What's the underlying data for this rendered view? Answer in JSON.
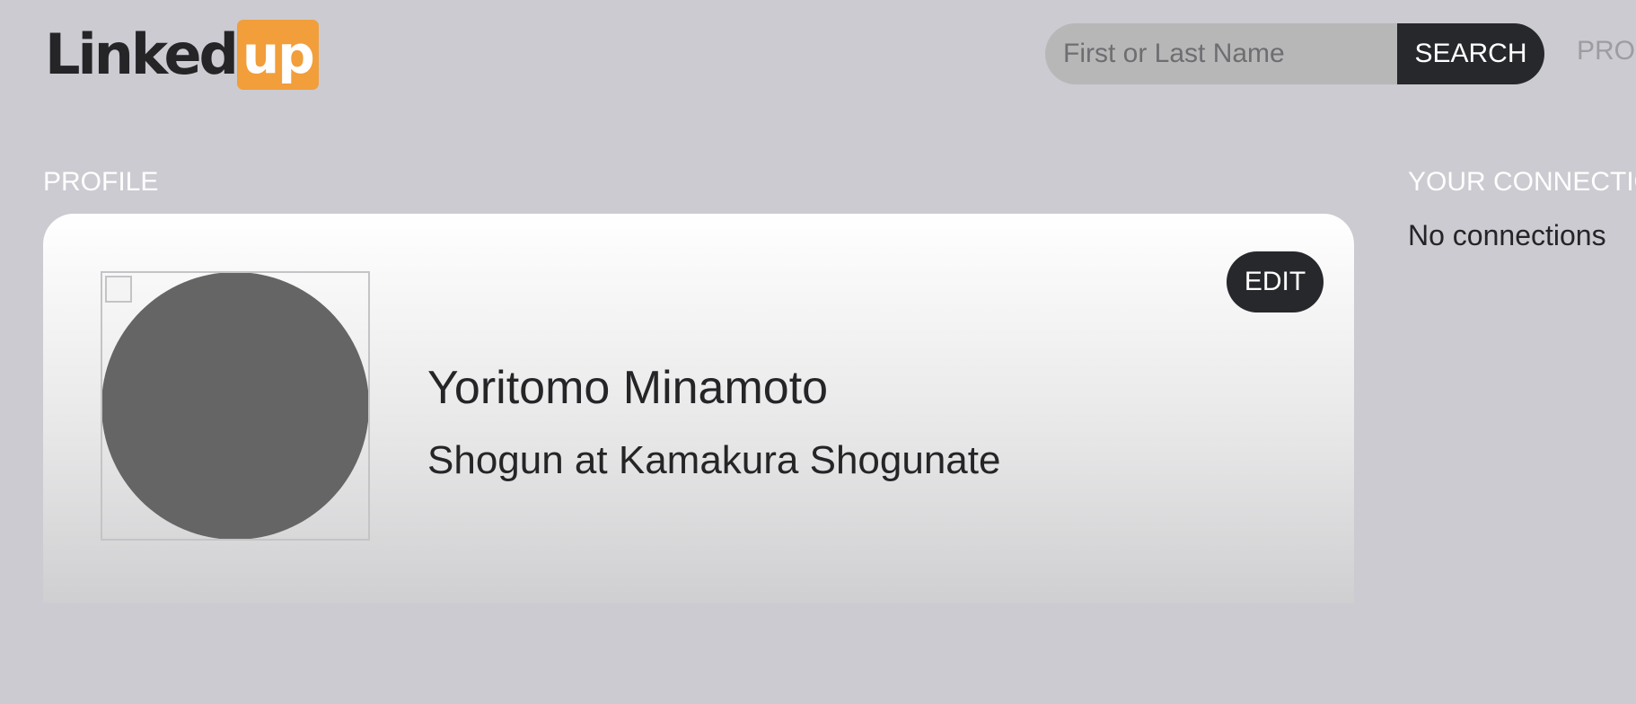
{
  "header": {
    "logo": {
      "text": "Linked",
      "highlight": "up",
      "highlight_color": "#f19e3b"
    },
    "search": {
      "placeholder": "First or Last Name",
      "value": "",
      "button_label": "SEARCH"
    },
    "nav": {
      "profile_label": "PROFILE"
    }
  },
  "profile_section": {
    "heading": "PROFILE",
    "card": {
      "edit_label": "EDIT",
      "avatar_icon": "broken-image-icon",
      "name": "Yoritomo Minamoto",
      "headline": "Shogun at Kamakura Shogunate"
    }
  },
  "connections_section": {
    "heading": "YOUR CONNECTIONS",
    "empty_text": "No connections"
  },
  "colors": {
    "background": "#cbcbd1",
    "dark_button": "#27282c",
    "accent": "#f19e3b"
  }
}
